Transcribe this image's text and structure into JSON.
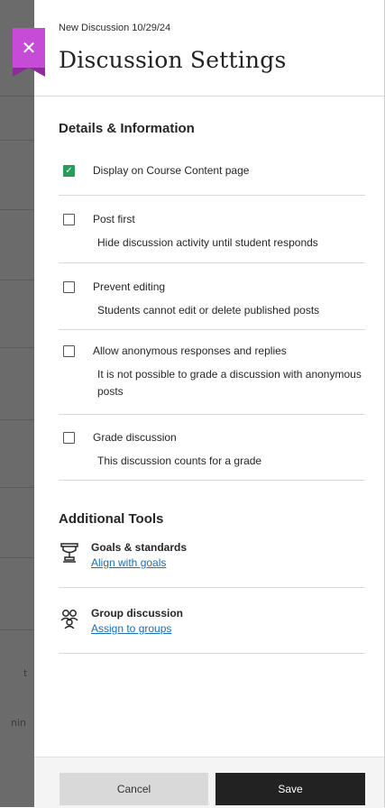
{
  "backdrop": {
    "fragments": [
      "t",
      "nin"
    ]
  },
  "close_glyph": "✕",
  "header": {
    "subtitle": "New Discussion 10/29/24",
    "title": "Discussion Settings"
  },
  "details": {
    "heading": "Details & Information",
    "options": [
      {
        "label": "Display on Course Content page",
        "checked": true,
        "desc": ""
      },
      {
        "label": "Post first",
        "checked": false,
        "desc": "Hide discussion activity until student responds"
      },
      {
        "label": "Prevent editing",
        "checked": false,
        "desc": "Students cannot edit or delete published posts"
      },
      {
        "label": "Allow anonymous responses and replies",
        "checked": false,
        "desc": "It is not possible to grade a discussion with anonymous posts"
      },
      {
        "label": "Grade discussion",
        "checked": false,
        "desc": "This discussion counts for a grade"
      }
    ]
  },
  "tools": {
    "heading": "Additional Tools",
    "items": [
      {
        "icon": "goals-icon",
        "title": "Goals & standards",
        "link": "Align with goals"
      },
      {
        "icon": "group-icon",
        "title": "Group discussion",
        "link": "Assign to groups"
      }
    ]
  },
  "footer": {
    "cancel_label": "Cancel",
    "save_label": "Save"
  },
  "colors": {
    "accent": "#c64bd6",
    "check": "#2a9b5b",
    "link": "#1a6fb5",
    "save_bg": "#222222"
  }
}
